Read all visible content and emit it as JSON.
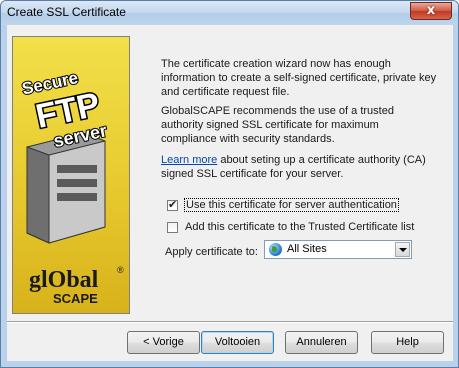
{
  "window": {
    "title": "Create SSL Certificate",
    "close_glyph": "x"
  },
  "banner": {
    "logo_lines": [
      "Secure",
      "FTP",
      "server"
    ],
    "brand_top": "glObal",
    "brand_bottom": "SCAPE",
    "registered": "®",
    "accent_color": "#e6c62a"
  },
  "body": {
    "para1": "The certificate creation wizard now has enough information to create a self-signed certificate, private key and certificate request file.",
    "para2": "GlobalSCAPE recommends the use of a trusted authority signed SSL certificate for maximum compliance with security standards.",
    "para3_link": "Learn more",
    "para3_rest": " about seting up a certificate authority (CA) signed SSL certificate for your server."
  },
  "options": {
    "use_for_server_auth": {
      "label": "Use this certificate for server authentication",
      "checked": true,
      "mark": "✔"
    },
    "add_to_trusted": {
      "label": "Add this certificate to the Trusted Certificate list",
      "checked": false
    }
  },
  "apply": {
    "label": "Apply certificate to:",
    "selected": "All Sites",
    "icon": "globe-icon"
  },
  "buttons": {
    "back": "< Vorige",
    "finish": "Voltooien",
    "cancel": "Annuleren",
    "help": "Help"
  }
}
